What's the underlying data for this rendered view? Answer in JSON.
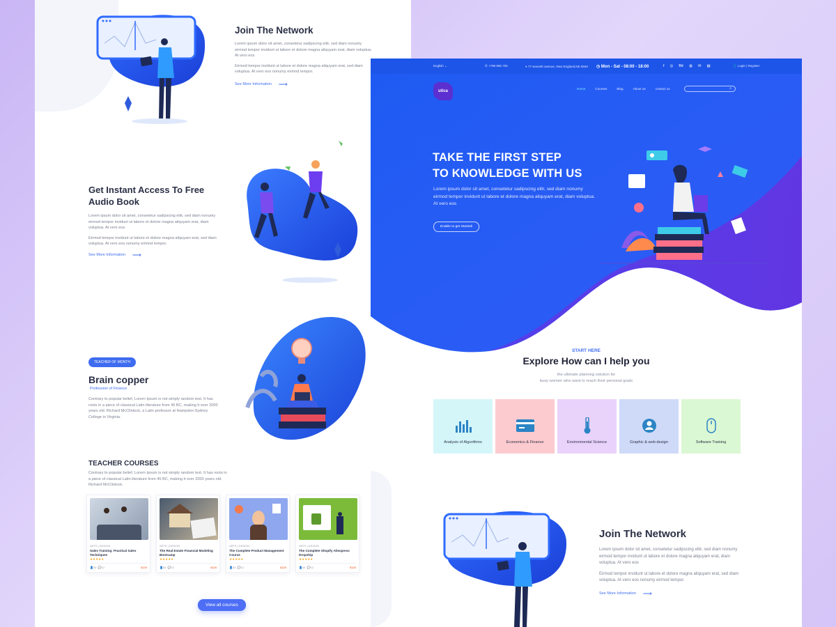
{
  "colors": {
    "primary": "#3e6cf0",
    "topbar": "#1d55e8",
    "hero_start": "#1c55f0",
    "hero_end": "#6a2fe0",
    "accent_orange": "#f27a4e"
  },
  "left": {
    "join_network": {
      "title": "Join The Network",
      "para1": "Lorem ipsum dolor sit amet, consetetur sadipscing elitr, sed diam nonumy eirmod tempor invidunt ut labore et dolore magna aliquyam erat, diam voluptua. At vero eos",
      "para2": "Eirmod tempor invidunt ut labore et dolore magna aliquyam erat, sed diam voluptua. At vero eos nonumy eirmod tempor.",
      "link": "See More Information"
    },
    "audio_book": {
      "title": "Get Instant Access To Free Audio Book",
      "para1": "Lorem ipsum dolor sit amet, consetetur sadipscing elitr, sed diam nonumy eirmod tempor invidunt ut labore et dolore magna aliquyam erat, diam voluptua. At vero eos",
      "para2": "Eirmod tempor invidunt ut labore et dolore magna aliquyam erat, sed diam voluptua. At vero eos nonumy eirmod tempor.",
      "link": "See More Information"
    },
    "teacher": {
      "badge": "TEACHER OF MONTH",
      "name": "Brain copper",
      "role": "Profession of Finance",
      "para": "Contrary to popular belief, Lorem Ipsum is not simply random text. It has roots in a piece of classical Latin literature from 45 BC, making it over 2000 years old. Richard McClintock, a Latin professor at Hampden-Sydney College in Virginia."
    },
    "courses": {
      "title": "TEACHER COURSES",
      "para": "Contrary to popular belief, Lorem Ipsum is not simply random text. It has roots in a piece of classical Latin literature from 45 BC, making it over 2000 years old. Richard McClintock.",
      "items": [
        {
          "tag": "ARTS | DESIGN",
          "title": "Sales Training: Practical Sales Techniques",
          "stars": "★★★★★",
          "students": "84",
          "comments": "12",
          "price": "$120"
        },
        {
          "tag": "ARTS | DESIGN",
          "title": "The Real Estate Financial Modeling Bootcamp",
          "stars": "★★★★★",
          "students": "84",
          "comments": "12",
          "price": "$120"
        },
        {
          "tag": "ARTS | DESIGN",
          "title": "The Complete Product Management Course",
          "stars": "★★★★★",
          "students": "84",
          "comments": "12",
          "price": "$120"
        },
        {
          "tag": "ARTS | DESIGN",
          "title": "The Complete Shopify Aliexpress Dropship",
          "stars": "★★★★★",
          "students": "84",
          "comments": "12",
          "price": "$120"
        }
      ],
      "view_all": "View all courses"
    }
  },
  "right": {
    "topbar": {
      "language": "English ⌄",
      "phone": "+789 895 756",
      "address": "77 seventh avenue, New England,NE 5840",
      "hours": "Mon - Sat - 08:00 - 18:00",
      "socials": [
        "f",
        "◎",
        "Bē",
        "◍",
        "✉",
        "▤"
      ],
      "login": "Login | Register"
    },
    "logo": "utica",
    "nav": [
      "Home",
      "Courses",
      "Blog",
      "About us",
      "contact us"
    ],
    "hero": {
      "title_line1": "TAKE THE FIRST STEP",
      "title_line2": "TO KNOWLEDGE WITH US",
      "text": "Lorem ipsum dolor sit amet, consetetur sadipscing elitr, sed diam nonumy eirmod tempor invidunt ut labore et dolore magna aliquyam erat, diam voluptua. At vero eos",
      "button": "Enable to get Started!"
    },
    "help": {
      "kicker": "START HERE",
      "title": "Explore How can I help you",
      "sub1": "the ultimate planning solution for",
      "sub2": "busy women who want to reach their personal goals"
    },
    "tiles": [
      {
        "label": "Analysis of Algorithms",
        "icon": "bar-chart-icon",
        "bg": "#d4f6f9",
        "fg": "#2c84c5"
      },
      {
        "label": "Economics & Finance",
        "icon": "money-card-icon",
        "bg": "#fccbd0",
        "fg": "#2c84c5"
      },
      {
        "label": "Environmental Science",
        "icon": "thermometer-icon",
        "bg": "#ead3fb",
        "fg": "#2c84c5"
      },
      {
        "label": "Graphic & web design",
        "icon": "user-badge-icon",
        "bg": "#cfdaf8",
        "fg": "#2c84c5"
      },
      {
        "label": "Software Training",
        "icon": "mouse-icon",
        "bg": "#dbf8d4",
        "fg": "#2c84c5"
      }
    ],
    "join_network": {
      "title": "Join The Network",
      "para1": "Lorem ipsum dolor sit amet, consetetur sadipscing elitr, sed diam nonumy eirmod tempor invidunt ut labore et dolore magna aliquyam erat, diam voluptua. At vero eos",
      "para2": "Eirmod tempor invidunt ut labore et dolore magna aliquyam erat, sed diam voluptua. At vero eos nonumy eirmod tempor.",
      "link": "See More Information"
    }
  }
}
